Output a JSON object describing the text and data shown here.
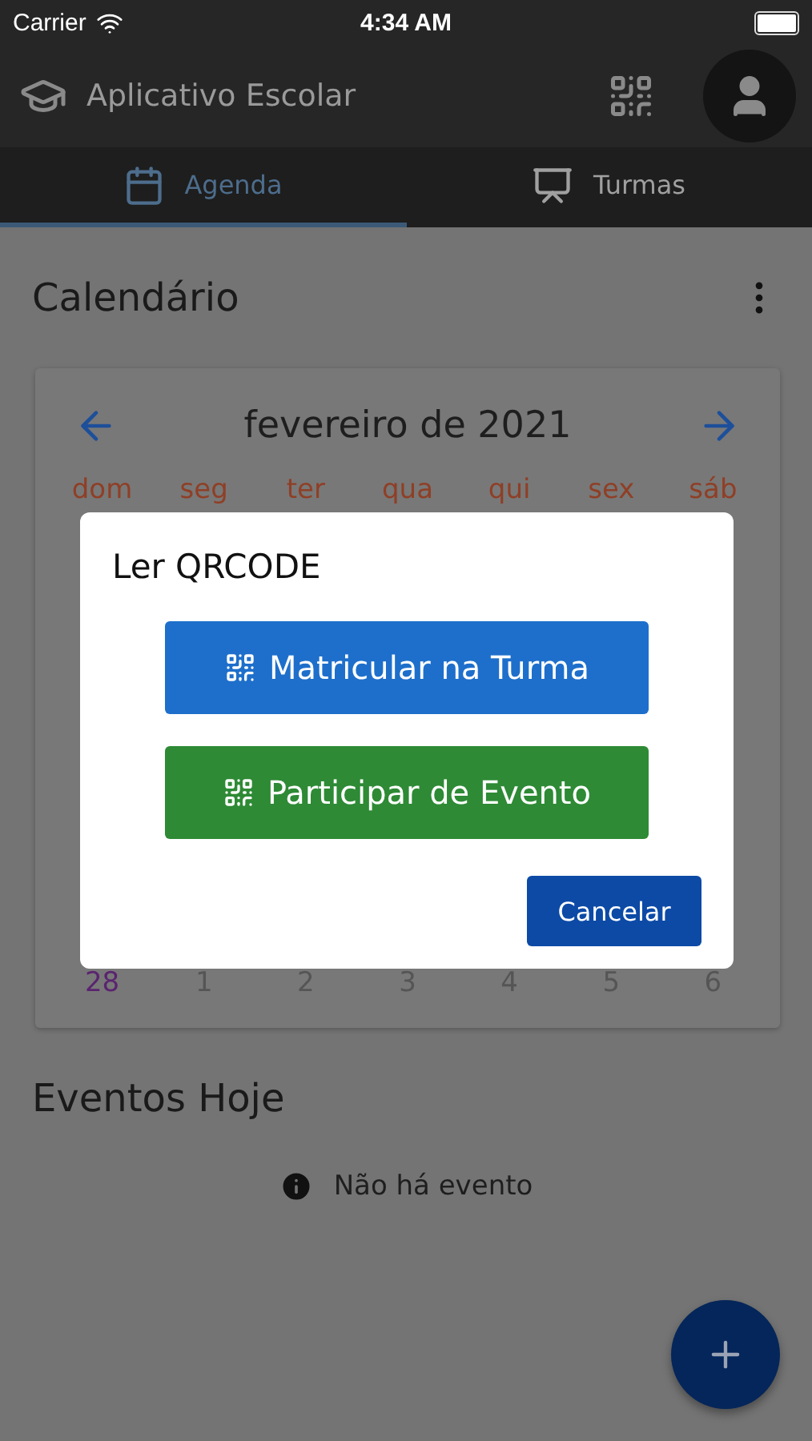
{
  "status_bar": {
    "carrier": "Carrier",
    "time": "4:34 AM"
  },
  "app_bar": {
    "title": "Aplicativo Escolar"
  },
  "tabs": [
    {
      "label": "Agenda",
      "kind": "calendar",
      "selected": true
    },
    {
      "label": "Turmas",
      "kind": "class",
      "selected": false
    }
  ],
  "calendar": {
    "title": "Calendário",
    "month": "fevereiro de 2021",
    "weekdays": [
      "dom",
      "seg",
      "ter",
      "qua",
      "qui",
      "sex",
      "sáb"
    ],
    "last_week": [
      {
        "label": "28",
        "outside_month": false
      },
      {
        "label": "1",
        "outside_month": true
      },
      {
        "label": "2",
        "outside_month": true
      },
      {
        "label": "3",
        "outside_month": true
      },
      {
        "label": "4",
        "outside_month": true
      },
      {
        "label": "5",
        "outside_month": true
      },
      {
        "label": "6",
        "outside_month": true
      }
    ]
  },
  "events": {
    "title": "Eventos Hoje",
    "empty_message": "Não há evento"
  },
  "dialog": {
    "title": "Ler QRCODE",
    "actions": [
      {
        "label": "Matricular na Turma",
        "kind": "primary"
      },
      {
        "label": "Participar de Evento",
        "kind": "success"
      }
    ],
    "cancel": "Cancelar"
  }
}
